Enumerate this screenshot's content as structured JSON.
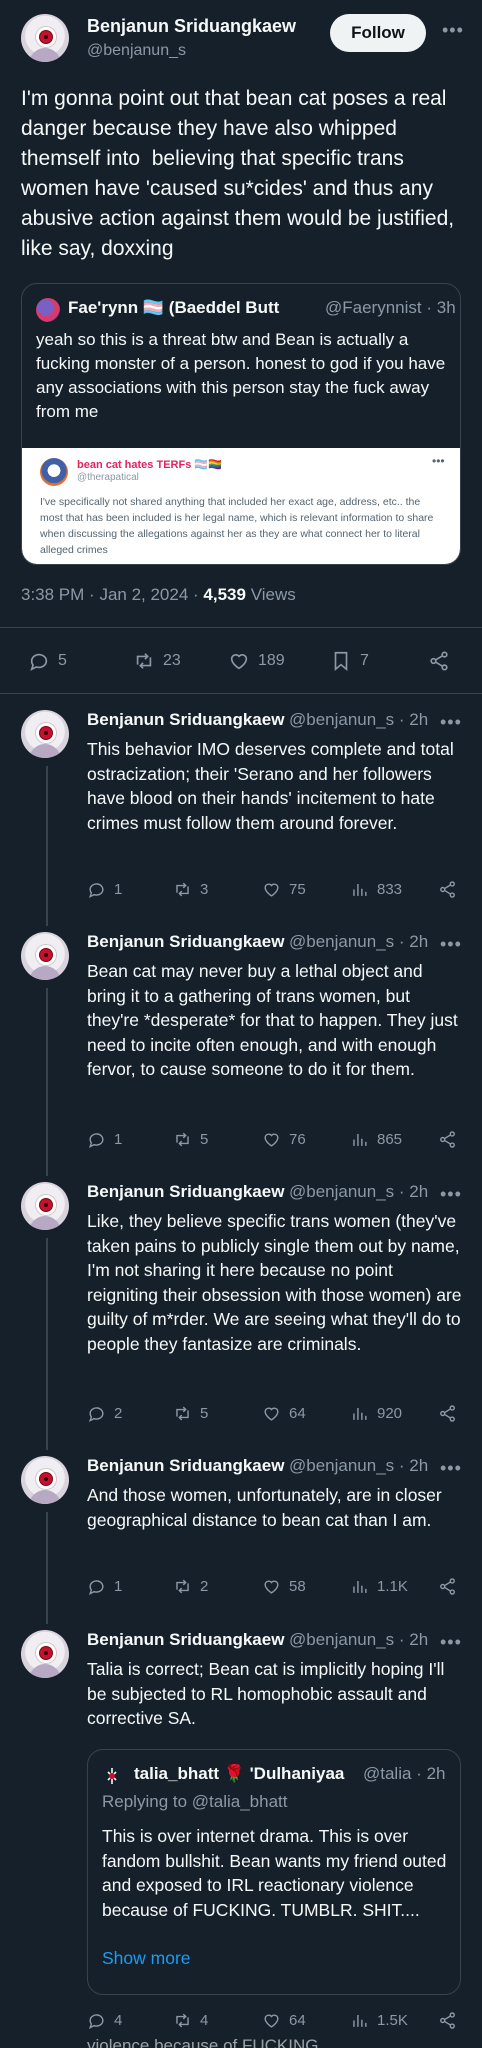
{
  "main_tweet": {
    "author_name": "Benjanun Sriduangkaew",
    "author_handle": "@benjanun_s",
    "follow_label": "Follow",
    "more_icon": "more-dots-icon",
    "text": "I'm gonna point out that bean cat poses a real danger because they have also whipped themself into  believing that specific trans women have 'caused su*cides' and thus any abusive action against them would be justified, like say, doxxing",
    "quoted_tweet": {
      "author_name": "Fae'rynn 🏳️‍⚧️ (Baeddel Butt",
      "author_handle": "@Faerynnist",
      "time": "3h",
      "text": "yeah so this is a threat btw and Bean is actually a fucking monster of a person. honest to god if you have any associations with this person stay the fuck away from me",
      "screenshot": {
        "name": "bean cat hates TERFs 🏳️‍⚧️🏳️‍🌈",
        "handle": "@therapatical",
        "text": "I've specifically not shared anything that included her exact age, address, etc.. the most that has been included is her legal name, which is relevant information to share when discussing the allegations against her as they are what connect her to literal alleged crimes"
      }
    },
    "time": "3:38 PM",
    "date": "Jan 2, 2024",
    "views_count": "4,539",
    "views_label": "Views",
    "stats": {
      "replies": "5",
      "retweets": "23",
      "likes": "189",
      "bookmarks": "7"
    }
  },
  "replies": [
    {
      "author_name": "Benjanun Sriduangkaew",
      "author_handle": "@benjanun_s",
      "time": "2h",
      "text": "This behavior IMO deserves complete and total ostracization; their 'Serano and her followers have blood on their hands' incitement to hate crimes must follow them around forever.",
      "stats": {
        "replies": "1",
        "retweets": "3",
        "likes": "75",
        "views": "833"
      }
    },
    {
      "author_name": "Benjanun Sriduangkaew",
      "author_handle": "@benjanun_s",
      "time": "2h",
      "text": "Bean cat may never buy a lethal object and bring it to a gathering of trans women, but they're *desperate* for that to happen. They just need to incite often enough, and with enough fervor, to cause someone to do it for them.",
      "stats": {
        "replies": "1",
        "retweets": "5",
        "likes": "76",
        "views": "865"
      }
    },
    {
      "author_name": "Benjanun Sriduangkaew",
      "author_handle": "@benjanun_s",
      "time": "2h",
      "text": "Like, they believe specific trans women (they've taken pains to publicly single them out by name, I'm not sharing it here because no point reigniting their obsession with those women) are guilty of m*rder. We are seeing what they'll do to people they fantasize are criminals.",
      "stats": {
        "replies": "2",
        "retweets": "5",
        "likes": "64",
        "views": "920"
      }
    },
    {
      "author_name": "Benjanun Sriduangkaew",
      "author_handle": "@benjanun_s",
      "time": "2h",
      "text": "And those women, unfortunately, are in closer geographical distance to bean cat than I am.",
      "stats": {
        "replies": "1",
        "retweets": "2",
        "likes": "58",
        "views": "1.1K"
      }
    },
    {
      "author_name": "Benjanun Sriduangkaew",
      "author_handle": "@benjanun_s",
      "time": "2h",
      "text": "Talia is correct; Bean cat is implicitly hoping I'll be subjected to RL homophobic assault and corrective SA.",
      "quoted_tweet": {
        "author_name": "talia_bhatt 🌹 'Dulhaniyaa",
        "author_handle": "@talia",
        "time": "2h",
        "replying_to": "Replying to @talia_bhatt",
        "text": "This is over internet drama. This is over fandom bullshit. Bean wants my friend outed and exposed to IRL reactionary violence because of FUCKING. TUMBLR. SHIT....",
        "show_more": "Show more"
      },
      "stats": {
        "replies": "4",
        "retweets": "4",
        "likes": "64",
        "views": "1.5K"
      }
    }
  ],
  "cut_off_text": "violence because of FUCKING."
}
